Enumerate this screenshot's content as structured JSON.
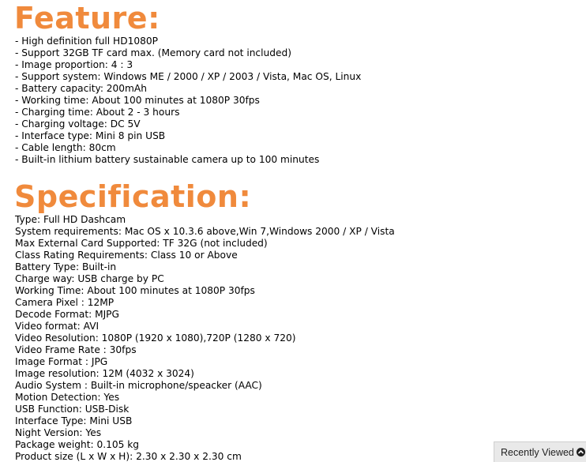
{
  "feature": {
    "heading": "Feature:",
    "items": [
      "- High definition full HD1080P",
      "- Support 32GB TF card max. (Memory card not included)",
      "- Image proportion: 4 : 3",
      "- Support system: Windows ME / 2000 / XP / 2003 / Vista, Mac OS, Linux",
      "- Battery capacity: 200mAh",
      "- Working time: About 100 minutes at 1080P 30fps",
      "- Charging time: About 2 - 3 hours",
      "- Charging voltage: DC 5V",
      "- Interface type: Mini 8 pin USB",
      "- Cable length: 80cm",
      "- Built-in lithium battery sustainable camera up to 100 minutes"
    ]
  },
  "specification": {
    "heading": "Specification:",
    "items": [
      "Type: Full HD Dashcam",
      "System requirements: Mac OS x 10.3.6 above,Win 7,Windows 2000 / XP / Vista",
      "Max External Card Supported: TF 32G (not included)",
      "Class Rating Requirements: Class 10 or Above",
      "Battery Type: Built-in",
      "Charge way: USB charge by PC",
      "Working Time: About 100 minutes at 1080P 30fps",
      "Camera Pixel : 12MP",
      "Decode Format: MJPG",
      "Video format: AVI",
      "Video Resolution: 1080P (1920 x 1080),720P (1280 x 720)",
      "Video Frame Rate : 30fps",
      "Image Format : JPG",
      "Image resolution: 12M (4032 x 3024)",
      "Audio System : Built-in microphone/speacker (AAC)",
      "Motion Detection: Yes",
      "USB Function: USB-Disk",
      "Interface Type: Mini USB",
      "Night Version: Yes",
      "Package weight: 0.105 kg",
      "Product size (L x W x H): 2.30 x 2.30 x 2.30 cm"
    ]
  },
  "recently_viewed": {
    "label": "Recently Viewed",
    "icon": "chevron-up-icon"
  },
  "colors": {
    "heading": "#f08a3c",
    "body_text": "#000000",
    "tab_background": "#e9e9e9"
  }
}
